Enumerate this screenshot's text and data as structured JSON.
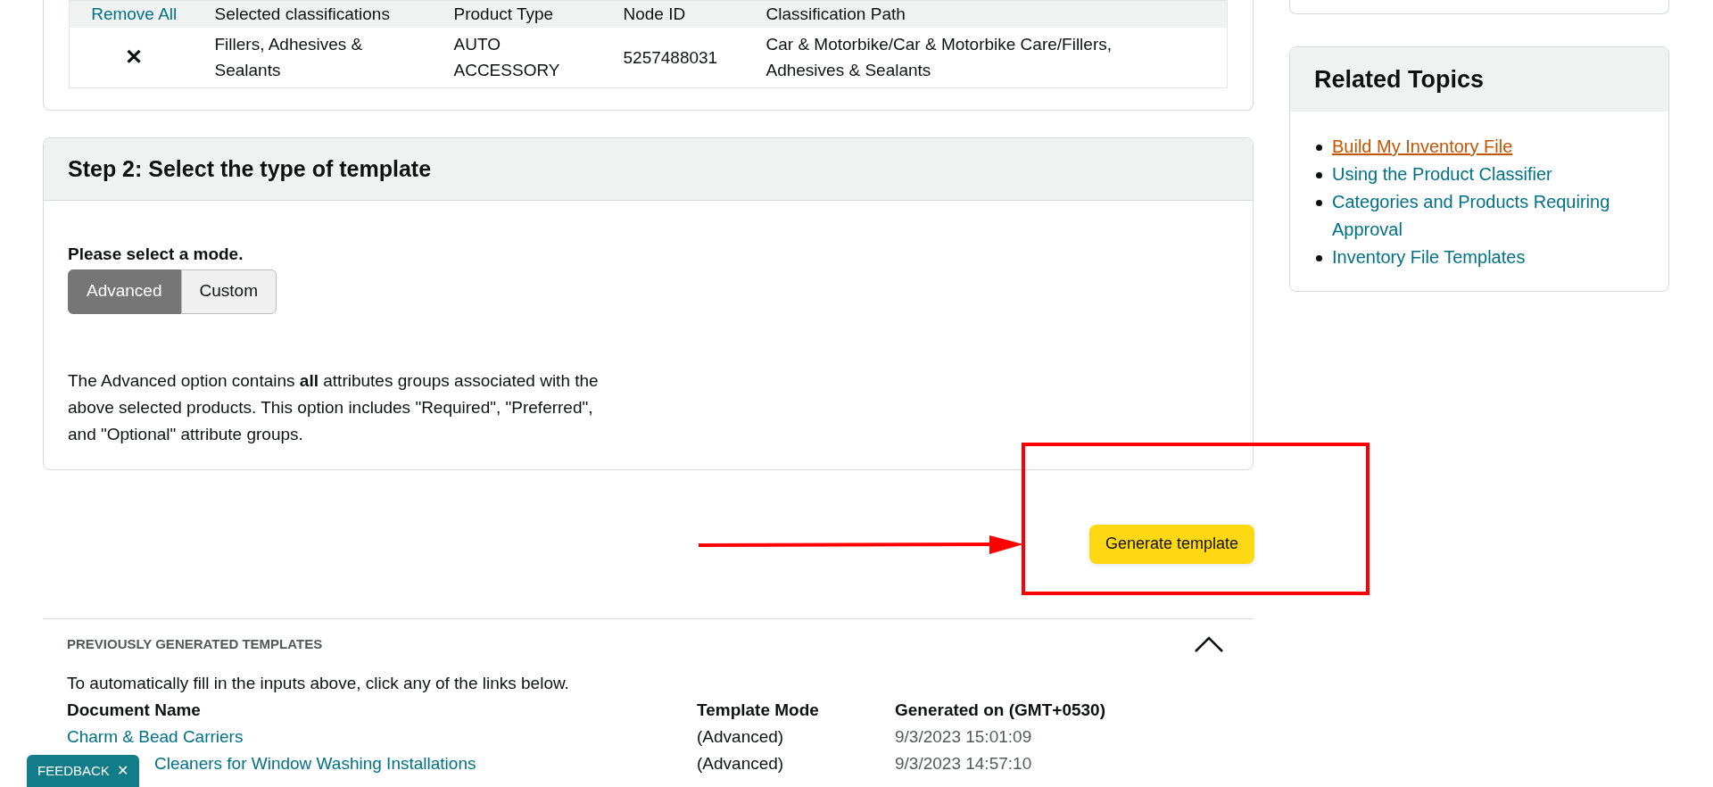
{
  "classifications_table": {
    "columns": [
      {
        "label": "Remove All",
        "kind": "link"
      },
      {
        "label": "Selected classifications",
        "kind": "text"
      },
      {
        "label": "Product Type",
        "kind": "text"
      },
      {
        "label": "Node ID",
        "kind": "text"
      },
      {
        "label": "Classification Path",
        "kind": "text"
      }
    ],
    "rows": [
      {
        "remove": "✕",
        "classification": "Fillers, Adhesives & Sealants",
        "product_type": "AUTO ACCESSORY",
        "node_id": "5257488031",
        "path": "Car & Motorbike/Car & Motorbike Care/Fillers, Adhesives & Sealants"
      }
    ]
  },
  "step2": {
    "title": "Step 2: Select the type of template",
    "mode_label": "Please select a mode.",
    "modes": [
      {
        "label": "Advanced",
        "selected": true
      },
      {
        "label": "Custom",
        "selected": false
      }
    ],
    "description": "The Advanced option contains **all** attributes groups associated with the above selected products. This option includes \"Required\", \"Preferred\", and \"Optional\" attribute groups."
  },
  "generate_button": "Generate template",
  "annotations": {
    "arrow": true,
    "highlight_box": true
  },
  "previous_templates": {
    "title": "PREVIOUSLY GENERATED TEMPLATES",
    "expanded": true,
    "instructions": "To automatically fill in the inputs above, click any of the links below.",
    "columns": [
      "Document Name",
      "Template Mode",
      "Generated on (GMT+0530)"
    ],
    "rows": [
      {
        "name": "Charm & Bead Carriers",
        "mode": "(Advanced)",
        "generated": "9/3/2023 15:01:09"
      },
      {
        "name": "Cleaners for Window Washing Installations",
        "mode": "(Advanced)",
        "generated": "9/3/2023 14:57:10"
      }
    ]
  },
  "related_topics": {
    "title": "Related Topics",
    "links": [
      {
        "label": "Build My Inventory File",
        "visited": true
      },
      {
        "label": "Using the Product Classifier",
        "visited": false
      },
      {
        "label": "Categories and Products Requiring Approval",
        "visited": false
      },
      {
        "label": "Inventory File Templates",
        "visited": false
      }
    ]
  },
  "feedback": {
    "label": "FEEDBACK",
    "close": "✕"
  }
}
